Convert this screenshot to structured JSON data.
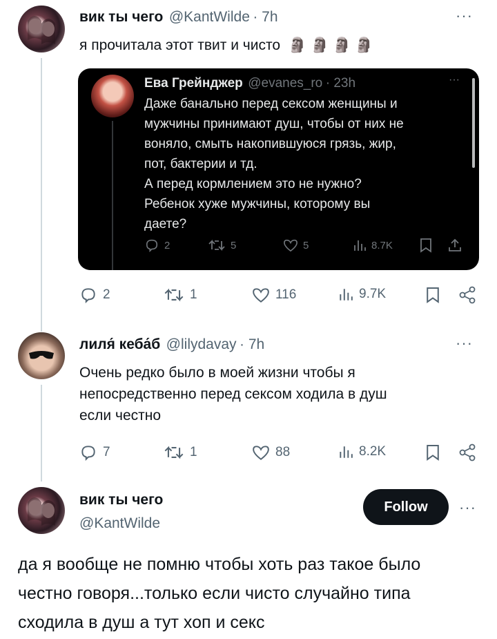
{
  "tweet1": {
    "name": "вик ты чего",
    "handle": "@KantWilde",
    "time": "7h",
    "text": "я прочитала этот твит и чисто",
    "emoji": "🗿🗿🗿🗿",
    "more": "···",
    "actions": {
      "reply": "2",
      "retweet": "1",
      "like": "116",
      "views": "9.7K"
    }
  },
  "quote": {
    "name": "Ева Грейнджер",
    "handle": "@evanes_ro",
    "time": "23h",
    "more": "···",
    "lines": [
      "Даже банально перед сексом женщины и",
      "мужчины принимают душ, чтобы от них не",
      "воняло, смыть накопившуюся грязь, жир,",
      "пот, бактерии и тд.",
      "А перед кормлением это не нужно?",
      "Ребенок хуже мужчины, которому вы",
      "даете?"
    ],
    "actions": {
      "reply": "2",
      "retweet": "5",
      "like": "5",
      "views": "8.7K"
    }
  },
  "tweet2": {
    "name": "лиля́ кеба́б",
    "handle": "@lilydavay",
    "time": "7h",
    "more": "···",
    "lines": [
      "Очень редко было в моей жизни чтобы я",
      "непосредственно перед сексом ходила в душ",
      "если честно"
    ],
    "actions": {
      "reply": "7",
      "retweet": "1",
      "like": "88",
      "views": "8.2K"
    }
  },
  "tweet3": {
    "name": "вик ты чего",
    "handle": "@KantWilde",
    "follow": "Follow",
    "more": "···",
    "lines": [
      "да я вообще не помню чтобы хоть раз такое было",
      "честно говоря...только если чисто случайно типа",
      "сходила в душ а тут хоп и секс"
    ]
  },
  "colors": {
    "text": "#0f1419",
    "muted": "#536471",
    "dark_card": "#000000",
    "line": "#cfd9de"
  }
}
